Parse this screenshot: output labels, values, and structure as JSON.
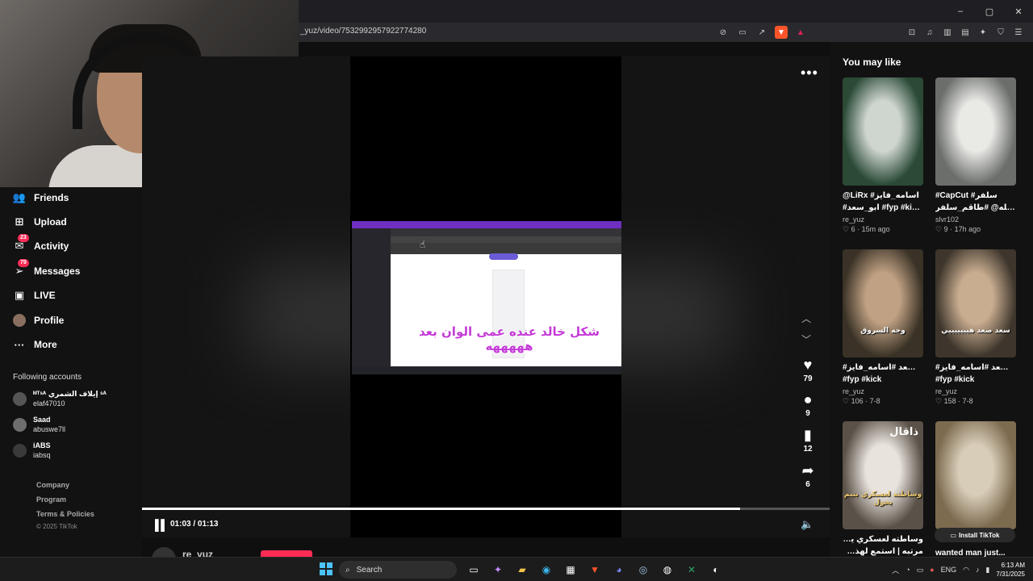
{
  "browser": {
    "url": "_yuz/video/7532992957922774280",
    "window_controls": [
      "–",
      "▢",
      "✕"
    ]
  },
  "nav": {
    "items": [
      {
        "label": "Friends",
        "icon": "friends-icon",
        "glyph": "👥"
      },
      {
        "label": "Upload",
        "icon": "upload-icon",
        "glyph": "⊞",
        "badge": ""
      },
      {
        "label": "Activity",
        "icon": "activity-icon",
        "glyph": "✉",
        "badge": "23"
      },
      {
        "label": "Messages",
        "icon": "messages-icon",
        "glyph": "➢",
        "badge": "79"
      },
      {
        "label": "LIVE",
        "icon": "live-icon",
        "glyph": "▣"
      },
      {
        "label": "Profile",
        "icon": "profile-icon",
        "glyph": ""
      },
      {
        "label": "More",
        "icon": "more-icon",
        "glyph": "···"
      }
    ],
    "following_title": "Following accounts",
    "following": [
      {
        "name": "ᴹᵀˢᴬ إيلاف الشمري ˢᴬ",
        "handle": "elaf47010"
      },
      {
        "name": "Saad",
        "handle": "abuswe7ll"
      },
      {
        "name": "iABS",
        "handle": "iabsq"
      }
    ],
    "footer": [
      "Company",
      "Program",
      "Terms & Policies"
    ],
    "copyright": "© 2025 TikTok"
  },
  "player": {
    "caption": "شكل خالد عنده عمى الوان بعد هههههه",
    "likes": "79",
    "comments": "9",
    "saves": "12",
    "shares": "6",
    "time": "01:03 / 01:13",
    "progress": 0.87,
    "author": "re_yuz"
  },
  "recommendations": {
    "title": "You may like",
    "items": [
      {
        "title1": "@LiRx #اسامه_فايز",
        "title2": "#ابو_سعد #fyp #kick...",
        "author": "re_yuz",
        "likes": "6",
        "age": "15m ago",
        "overlay": "",
        "brand": "",
        "colors": [
          "#2a4a36",
          "#cfd6d0"
        ]
      },
      {
        "title1": "#CapCut #سلفر",
        "title2": "سلفر_الله@ #طاقم_سلفر_...",
        "author": "slvr102",
        "likes": "9",
        "age": "17h ago",
        "overlay": "",
        "brand": "",
        "colors": [
          "#6b6e6a",
          "#e9e9e6"
        ]
      },
      {
        "title1": "#ابو_سعد #اسامه_فايز",
        "title2": "#fyp #kick",
        "author": "re_yuz",
        "likes": "106",
        "age": "7-8",
        "overlay": "وجه السروق",
        "brand": "",
        "colors": [
          "#3a3226",
          "#c0a183"
        ]
      },
      {
        "title1": "#ابو_سعد #اسامه_فايز",
        "title2": "#fyp #kick",
        "author": "re_yuz",
        "likes": "158",
        "age": "7-8",
        "overlay": "سعد صعد هيييييييي",
        "brand": "",
        "colors": [
          "#3e362c",
          "#c9ad90"
        ]
      },
      {
        "title1": "وساطته لعسكري يتيم يحول",
        "title2": "مرتبه | استمع لهذه الحلقة على...",
        "author": "",
        "likes": "",
        "age": "",
        "overlay": "وساطته لعسكري يتيم يحول",
        "brand": "ذاقال",
        "colors": [
          "#5a5148",
          "#e8e3dc"
        ]
      },
      {
        "title1": "wanted man just...",
        "title2": "",
        "author": "",
        "likes": "",
        "age": "",
        "overlay": "",
        "brand": "",
        "colors": [
          "#7d6b50",
          "#d8cdb8"
        ]
      }
    ],
    "install": "Install TikTok"
  },
  "taskbar": {
    "search": "Search",
    "lang": "ENG",
    "time": "6:13 AM",
    "date": "7/31/2025"
  }
}
